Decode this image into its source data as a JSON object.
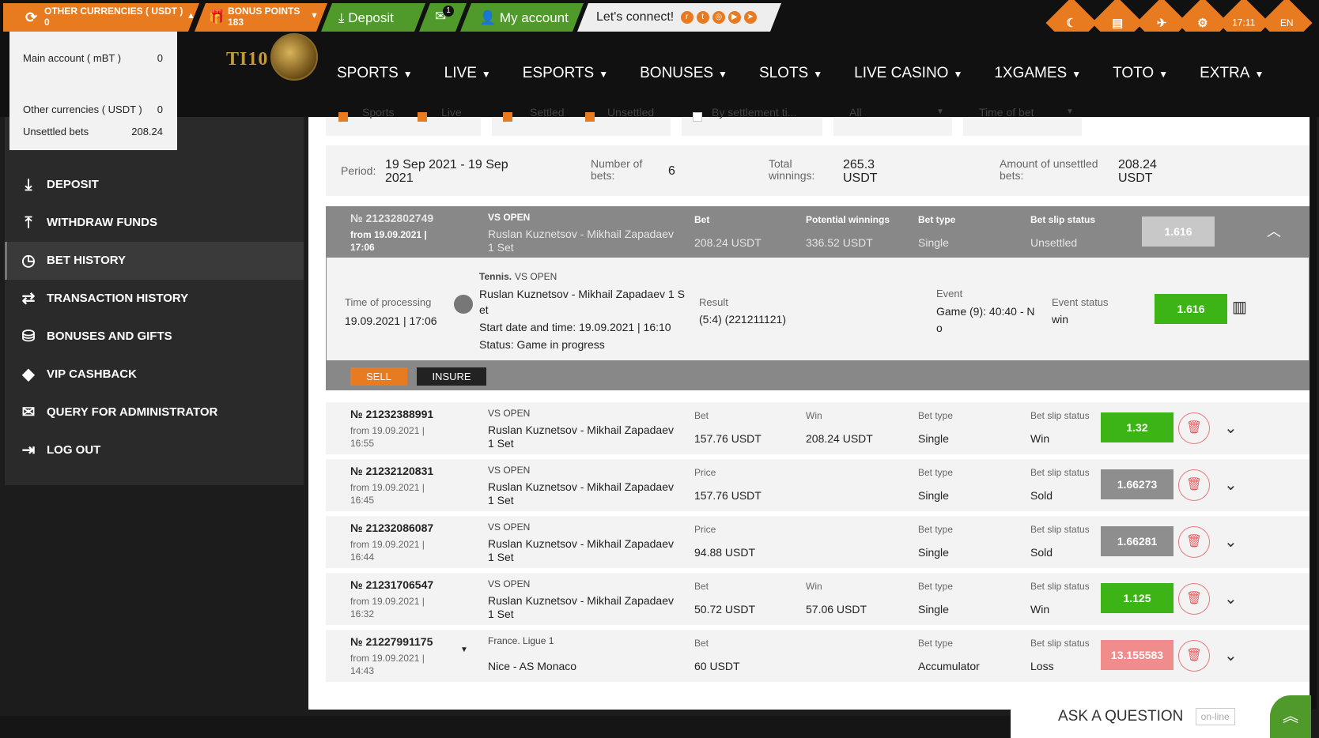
{
  "topbar": {
    "currency_label": "OTHER CURRENCIES ( USDT )",
    "currency_value": "0",
    "bonus_label": "BONUS POINTS",
    "bonus_value": "183",
    "deposit": "Deposit",
    "mail_badge": "1",
    "account": "My account",
    "connect": "Let's connect!",
    "time": "17:11",
    "lang": "EN"
  },
  "logo": {
    "text": "TI10"
  },
  "nav": [
    "SPORTS",
    "LIVE",
    "ESPORTS",
    "BONUSES",
    "SLOTS",
    "LIVE CASINO",
    "1XGAMES",
    "TOTO",
    "EXTRA"
  ],
  "dropdown": {
    "main_label": "Main account ( mBT )",
    "main_value": "0",
    "other_label": "Other currencies ( USDT )",
    "other_value": "0",
    "unsettled_label": "Unsettled bets",
    "unsettled_value": "208.24"
  },
  "sidebar": [
    "DEPOSIT",
    "WITHDRAW FUNDS",
    "BET HISTORY",
    "TRANSACTION HISTORY",
    "BONUSES AND GIFTS",
    "VIP CASHBACK",
    "QUERY FOR ADMINISTRATOR",
    "LOG OUT"
  ],
  "filters": {
    "sports": "Sports",
    "live": "Live",
    "settled": "Settled",
    "unsettled": "Unsettled",
    "by_settlement": "By settlement ti...",
    "all": "All",
    "time_of_bet": "Time of bet"
  },
  "period": {
    "period_label": "Period:",
    "period_value": "19 Sep 2021 - 19 Sep 2021",
    "bets_label": "Number of bets:",
    "bets_value": "6",
    "win_label": "Total winnings:",
    "win_value": "265.3 USDT",
    "unsettled_label": "Amount of unsettled bets:",
    "unsettled_value": "208.24 USDT"
  },
  "expanded": {
    "number": "№ 21232802749",
    "from": "from 19.09.2021 | 17:06",
    "tournament": "VS OPEN",
    "match": "Ruslan Kuznetsov - Mikhail Zapadaev 1 Set",
    "bet_label": "Bet",
    "bet_value": "208.24 USDT",
    "pot_label": "Potential winnings",
    "pot_value": "336.52 USDT",
    "type_label": "Bet type",
    "type_value": "Single",
    "status_label": "Bet slip status",
    "status_value": "Unsettled",
    "coef": "1.616",
    "processing_label": "Time of processing",
    "processing_value": "19.09.2021 | 17:06",
    "sport": "Tennis.",
    "sport_tour": "VS OPEN",
    "match_full": "Ruslan Kuznetsov - Mikhail Zapadaev 1 Set",
    "start": "Start date and time: 19.09.2021 | 16:10",
    "game_status": "Status: Game in progress",
    "result_label": "Result",
    "result_value": "(5:4) (221211121)",
    "event_label": "Event",
    "event_value": "Game (9): 40:40 - No",
    "event_status_label": "Event status",
    "event_status_value": "win",
    "detail_coef": "1.616",
    "sell": "SELL",
    "insure": "INSURE"
  },
  "bets": [
    {
      "number": "№ 21232388991",
      "from": "from 19.09.2021 | 16:55",
      "ev1": "VS OPEN",
      "ev2": "Ruslan Kuznetsov - Mikhail Zapadaev 1 Set",
      "c1l": "Bet",
      "c1v": "157.76 USDT",
      "c2l": "Win",
      "c2v": "208.24 USDT",
      "tl": "Bet type",
      "tv": "Single",
      "sl": "Bet slip status",
      "sv": "Win",
      "coef": "1.32",
      "color": "green"
    },
    {
      "number": "№ 21232120831",
      "from": "from 19.09.2021 | 16:45",
      "ev1": "VS OPEN",
      "ev2": "Ruslan Kuznetsov - Mikhail Zapadaev 1 Set",
      "c1l": "Price",
      "c1v": "157.76 USDT",
      "c2l": "",
      "c2v": "",
      "tl": "Bet type",
      "tv": "Single",
      "sl": "Bet slip status",
      "sv": "Sold",
      "coef": "1.66273",
      "color": "gray"
    },
    {
      "number": "№ 21232086087",
      "from": "from 19.09.2021 | 16:44",
      "ev1": "VS OPEN",
      "ev2": "Ruslan Kuznetsov - Mikhail Zapadaev 1 Set",
      "c1l": "Price",
      "c1v": "94.88 USDT",
      "c2l": "",
      "c2v": "",
      "tl": "Bet type",
      "tv": "Single",
      "sl": "Bet slip status",
      "sv": "Sold",
      "coef": "1.66281",
      "color": "gray"
    },
    {
      "number": "№ 21231706547",
      "from": "from 19.09.2021 | 16:32",
      "ev1": "VS OPEN",
      "ev2": "Ruslan Kuznetsov - Mikhail Zapadaev 1 Set",
      "c1l": "Bet",
      "c1v": "50.72 USDT",
      "c2l": "Win",
      "c2v": "57.06 USDT",
      "tl": "Bet type",
      "tv": "Single",
      "sl": "Bet slip status",
      "sv": "Win",
      "coef": "1.125",
      "color": "green"
    },
    {
      "number": "№ 21227991175",
      "from": "from 19.09.2021 | 14:43",
      "ev1": "France. Ligue 1",
      "ev2": "Nice - AS Monaco",
      "c1l": "Bet",
      "c1v": "60 USDT",
      "c2l": "",
      "c2v": "",
      "tl": "Bet type",
      "tv": "Accumulator",
      "sl": "Bet slip status",
      "sv": "Loss",
      "coef": "13.155583",
      "color": "pink"
    }
  ],
  "ask": {
    "label": "ASK A QUESTION",
    "online": "on-line"
  },
  "colors": {
    "accent": "#e87a1f",
    "green": "#3cb416",
    "gray": "#8e8e8e",
    "pink": "#f08c8c"
  }
}
